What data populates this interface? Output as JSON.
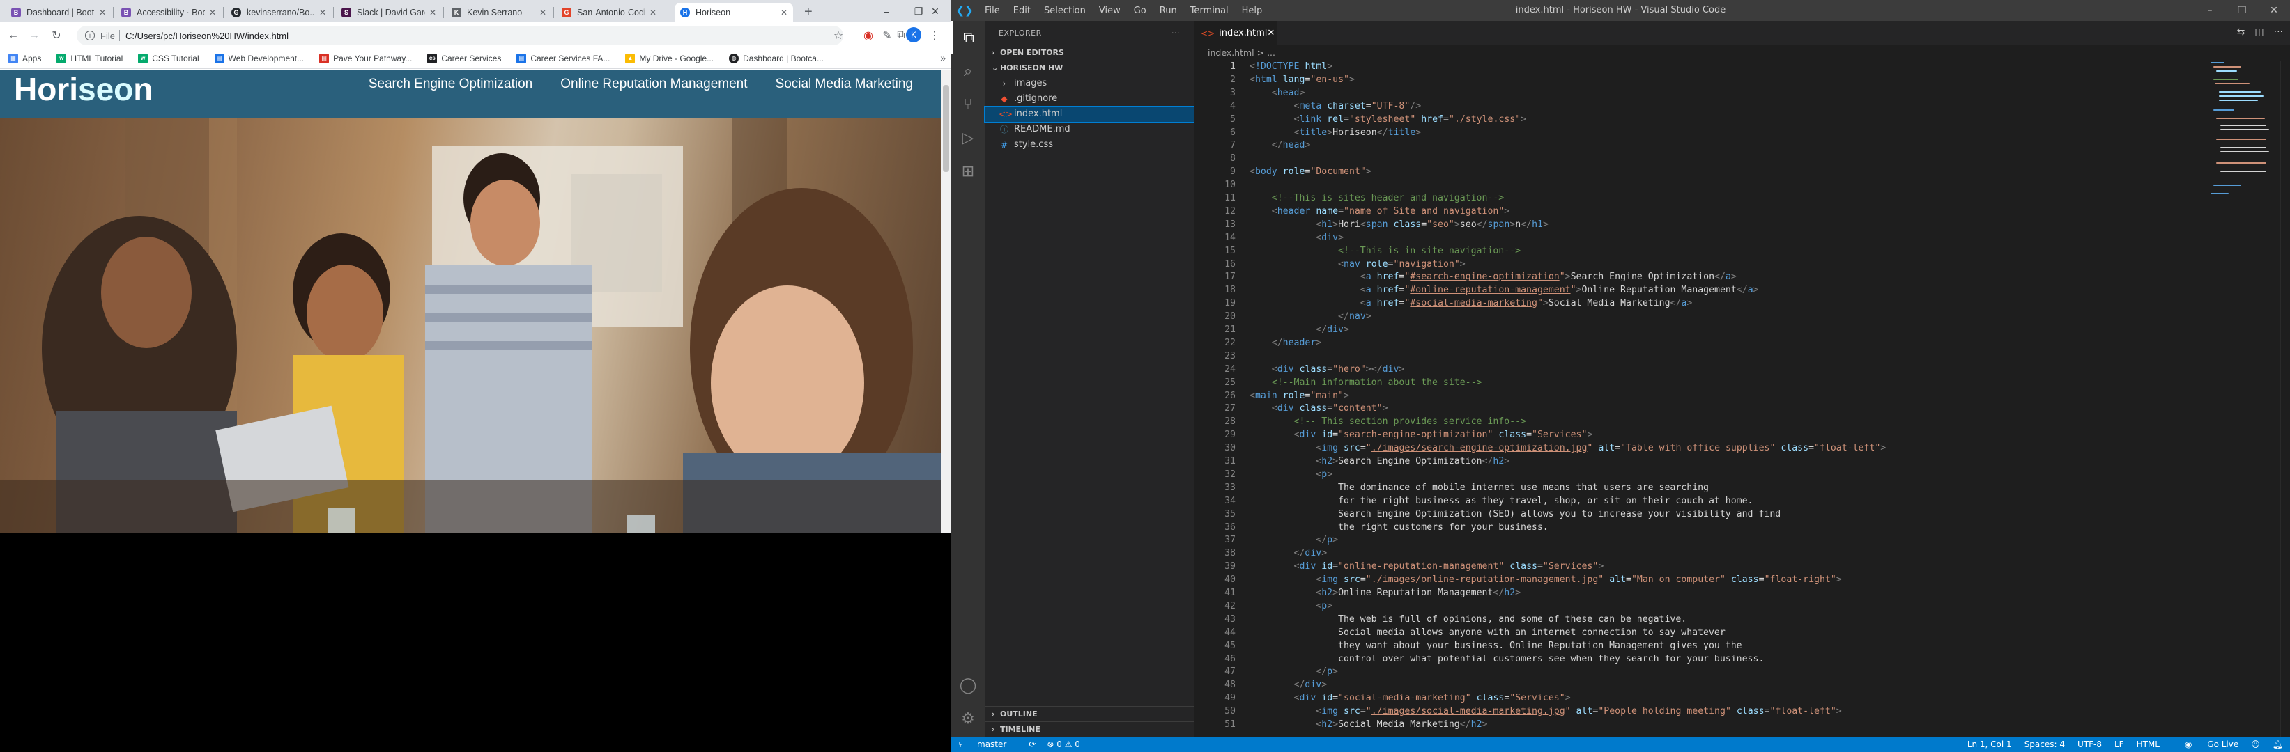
{
  "chrome": {
    "tabs": [
      {
        "label": "Dashboard | Boot...",
        "favicon_color": "#7952b3",
        "favicon_letter": "B"
      },
      {
        "label": "Accessibility · Boo...",
        "favicon_color": "#7952b3",
        "favicon_letter": "B"
      },
      {
        "label": "kevinserrano/Bo...",
        "favicon_color": "#24292e",
        "favicon_letter": "G"
      },
      {
        "label": "Slack | David Garc...",
        "favicon_color": "#4a154b",
        "favicon_letter": "S"
      },
      {
        "label": "Kevin Serrano",
        "favicon_color": "#5f6368",
        "favicon_letter": "K"
      },
      {
        "label": "San-Antonio-Codi...",
        "favicon_color": "#e24329",
        "favicon_letter": "G"
      },
      {
        "label": "Horiseon",
        "favicon_color": "#1a73e8",
        "favicon_letter": "H"
      }
    ],
    "new_tab": "+",
    "window_controls": {
      "minimize": "–",
      "maximize": "❐",
      "close": "✕"
    },
    "address": {
      "scheme": "File",
      "url": "C:/Users/pc/Horiseon%20HW/index.html"
    },
    "avatar_letter": "K",
    "bookmarks": [
      {
        "label": "Apps",
        "color": "#4285f4"
      },
      {
        "label": "HTML Tutorial",
        "color": "#04aa6d"
      },
      {
        "label": "CSS Tutorial",
        "color": "#04aa6d"
      },
      {
        "label": "Web Development...",
        "color": "#1a73e8"
      },
      {
        "label": "Pave Your Pathway...",
        "color": "#d93025"
      },
      {
        "label": "Career Services",
        "color": "#202124"
      },
      {
        "label": "Career Services FA...",
        "color": "#1a73e8"
      },
      {
        "label": "My Drive - Google...",
        "color": "#fbbc04"
      },
      {
        "label": "Dashboard | Bootca...",
        "color": "#202124"
      }
    ]
  },
  "site": {
    "brand_start": "Hori",
    "brand_seo": "seo",
    "brand_end": "n",
    "nav": [
      "Search Engine Optimization",
      "Online Reputation Management",
      "Social Media Marketing"
    ]
  },
  "vscode": {
    "menus": [
      "File",
      "Edit",
      "Selection",
      "View",
      "Go",
      "Run",
      "Terminal",
      "Help"
    ],
    "window_title": "index.html - Horiseon HW - Visual Studio Code",
    "explorer": {
      "title": "EXPLORER",
      "open_editors": "OPEN EDITORS",
      "project": "HORISEON HW",
      "files": [
        {
          "name": "images",
          "icon": "›",
          "color": "#ccc"
        },
        {
          "name": ".gitignore",
          "icon": "◆",
          "color": "#f05033"
        },
        {
          "name": "index.html",
          "icon": "<>",
          "color": "#e44d26"
        },
        {
          "name": "README.md",
          "icon": "ⓘ",
          "color": "#519aba"
        },
        {
          "name": "style.css",
          "icon": "#",
          "color": "#42a5f5"
        }
      ],
      "outline": "OUTLINE",
      "timeline": "TIMELINE"
    },
    "tab": {
      "label": "index.html",
      "close": "✕"
    },
    "breadcrumb": "index.html > ...",
    "status": {
      "branch": "master",
      "sync": "⟳",
      "problems": "⊗ 0 ⚠ 0",
      "position": "Ln 1, Col 1",
      "spaces": "Spaces: 4",
      "encoding": "UTF-8",
      "eol": "LF",
      "language": "HTML",
      "live": "Go Live"
    }
  }
}
